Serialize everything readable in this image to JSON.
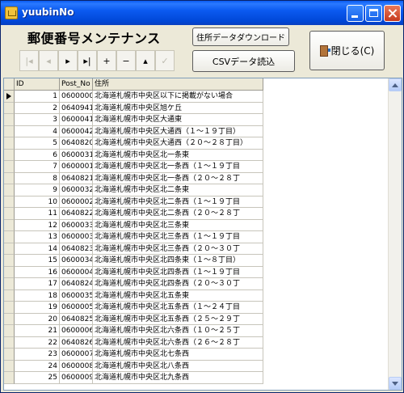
{
  "window": {
    "title": "yuubinNo"
  },
  "toolbar": {
    "heading": "郵便番号メンテナンス",
    "download_label": "住所データダウンロード",
    "csv_label": "CSVデータ読込",
    "close_label": "閉じる(C)"
  },
  "navigator": {
    "buttons": [
      "|◂",
      "◂",
      "▸",
      "▸|",
      "+",
      "−",
      "▴",
      "✓"
    ]
  },
  "table": {
    "columns": [
      "ID",
      "Post_No",
      "住所"
    ],
    "rows": [
      [
        "1",
        "0600000",
        "北海道札幌市中央区以下に掲載がない場合"
      ],
      [
        "2",
        "0640941",
        "北海道札幌市中央区旭ケ丘"
      ],
      [
        "3",
        "0600041",
        "北海道札幌市中央区大通東"
      ],
      [
        "4",
        "0600042",
        "北海道札幌市中央区大通西（１～１９丁目）"
      ],
      [
        "5",
        "0640820",
        "北海道札幌市中央区大通西（２０～２８丁目）"
      ],
      [
        "6",
        "0600031",
        "北海道札幌市中央区北一条東"
      ],
      [
        "7",
        "0600001",
        "北海道札幌市中央区北一条西（１～１９丁目"
      ],
      [
        "8",
        "0640821",
        "北海道札幌市中央区北一条西（２０～２８丁"
      ],
      [
        "9",
        "0600032",
        "北海道札幌市中央区北二条東"
      ],
      [
        "10",
        "0600002",
        "北海道札幌市中央区北二条西（１～１９丁目"
      ],
      [
        "11",
        "0640822",
        "北海道札幌市中央区北二条西（２０～２８丁"
      ],
      [
        "12",
        "0600033",
        "北海道札幌市中央区北三条東"
      ],
      [
        "13",
        "0600003",
        "北海道札幌市中央区北三条西（１～１９丁目"
      ],
      [
        "14",
        "0640823",
        "北海道札幌市中央区北三条西（２０～３０丁"
      ],
      [
        "15",
        "0600034",
        "北海道札幌市中央区北四条東（１～８丁目）"
      ],
      [
        "16",
        "0600004",
        "北海道札幌市中央区北四条西（１～１９丁目"
      ],
      [
        "17",
        "0640824",
        "北海道札幌市中央区北四条西（２０～３０丁"
      ],
      [
        "18",
        "0600035",
        "北海道札幌市中央区北五条東"
      ],
      [
        "19",
        "0600005",
        "北海道札幌市中央区北五条西（１～２４丁目"
      ],
      [
        "20",
        "0640825",
        "北海道札幌市中央区北五条西（２５～２９丁"
      ],
      [
        "21",
        "0600006",
        "北海道札幌市中央区北六条西（１０～２５丁"
      ],
      [
        "22",
        "0640826",
        "北海道札幌市中央区北六条西（２６～２８丁"
      ],
      [
        "23",
        "0600007",
        "北海道札幌市中央区北七条西"
      ],
      [
        "24",
        "0600008",
        "北海道札幌市中央区北八条西"
      ],
      [
        "25",
        "0600009",
        "北海道札幌市中央区北九条西"
      ]
    ]
  }
}
